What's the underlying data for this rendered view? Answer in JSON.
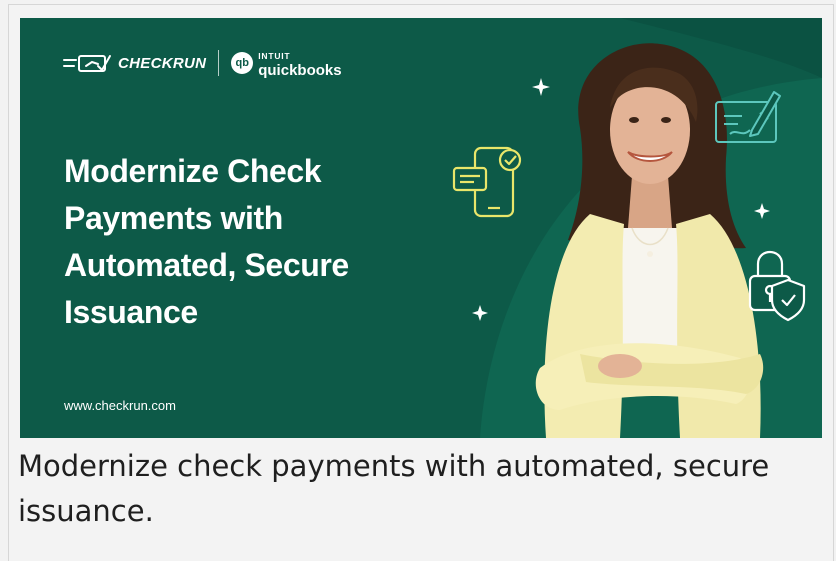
{
  "banner": {
    "brand": {
      "checkrun_wordmark": "CHECKRUN",
      "qb_logo_glyph": "qb",
      "intuit_label": "INTUIT",
      "quickbooks_label": "quickbooks"
    },
    "headline_lines": [
      "Modernize Check",
      "Payments with",
      "Automated, Secure",
      "Issuance"
    ],
    "url": "www.checkrun.com",
    "icons": [
      "sparkle-icon",
      "mobile-payment-icon",
      "signed-check-icon",
      "security-lock-icon"
    ],
    "colors": {
      "background": "#0d5a48",
      "accent_shape": "#0f6651",
      "icon_yellow": "#e9e66a",
      "icon_teal": "#5cc7bd",
      "text": "#ffffff"
    }
  },
  "caption": "Modernize check payments with automated, secure issuance."
}
